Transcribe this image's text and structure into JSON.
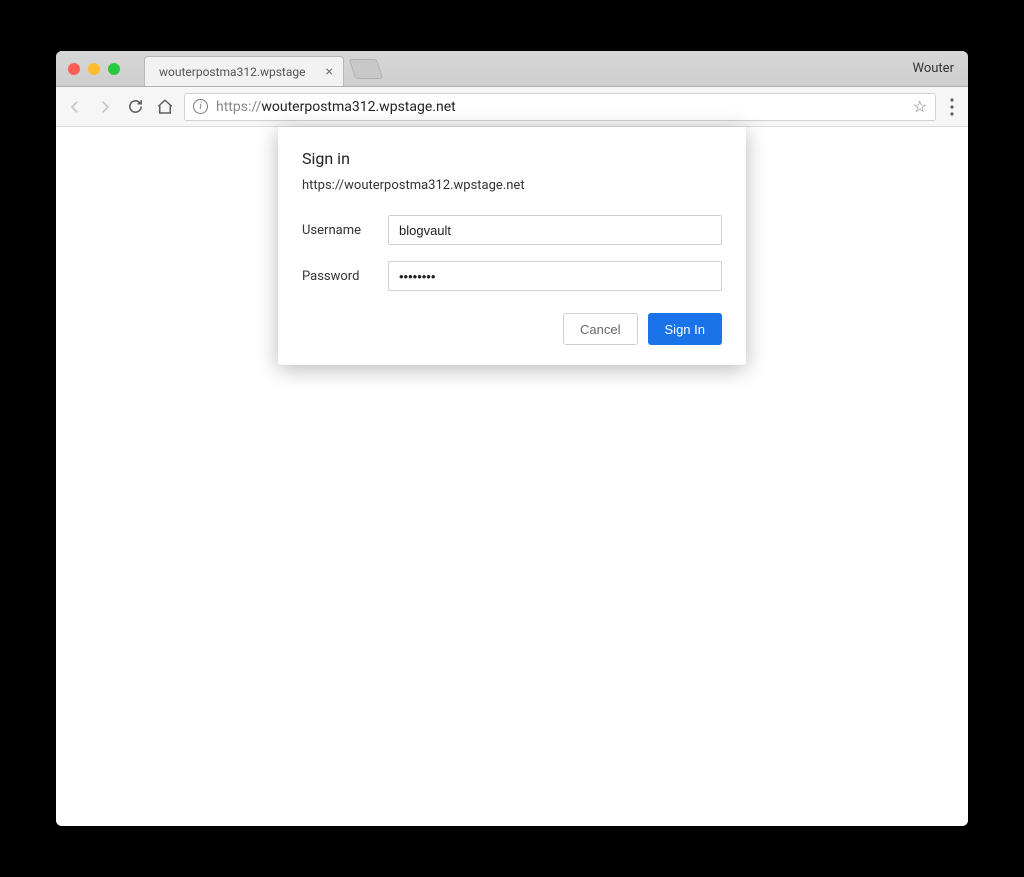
{
  "profile": {
    "name": "Wouter"
  },
  "tab": {
    "title": "wouterpostma312.wpstage"
  },
  "omnibox": {
    "scheme": "https://",
    "host": "wouterpostma312.wpstage.net"
  },
  "dialog": {
    "title": "Sign in",
    "host": "https://wouterpostma312.wpstage.net",
    "username_label": "Username",
    "password_label": "Password",
    "username_value": "blogvault",
    "password_value": "••••••••",
    "cancel_label": "Cancel",
    "signin_label": "Sign In"
  }
}
